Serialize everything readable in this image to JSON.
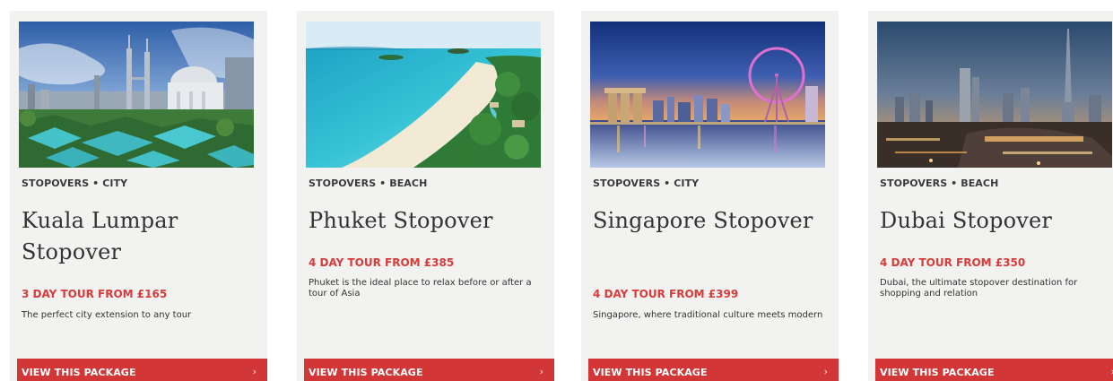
{
  "accent_color": "#d33636",
  "cards": [
    {
      "image_alt": "Kuala Lumpur skyline with Petronas Towers and mosque",
      "category": "STOPOVERS • CITY",
      "title": "Kuala Lumpar Stopover",
      "price": "3 DAY TOUR FROM £165",
      "description": "The perfect city extension to any tour",
      "cta_label": "VIEW THIS PACKAGE",
      "cta_icon": "chevron-right-icon"
    },
    {
      "image_alt": "Phuket tropical beach coastline",
      "category": "STOPOVERS • BEACH",
      "title": "Phuket Stopover",
      "price": "4 DAY TOUR FROM £385",
      "description": "Phuket is the ideal place to relax before or after a tour of Asia",
      "cta_label": "VIEW THIS PACKAGE",
      "cta_icon": "chevron-right-icon"
    },
    {
      "image_alt": "Singapore skyline at dusk with Ferris wheel",
      "category": "STOPOVERS • CITY",
      "title": "Singapore Stopover",
      "price": "4 DAY TOUR FROM £399",
      "description": "Singapore, where traditional culture meets modern",
      "cta_label": "VIEW THIS PACKAGE",
      "cta_icon": "chevron-right-icon"
    },
    {
      "image_alt": "Dubai skyline at dusk with Burj Khalifa",
      "category": "STOPOVERS • BEACH",
      "title": "Dubai Stopover",
      "price": "4 DAY TOUR FROM £350",
      "description": "Dubai, the ultimate stopover destination for shopping and relation",
      "cta_label": "VIEW THIS PACKAGE",
      "cta_icon": "chevron-right-icon"
    }
  ]
}
